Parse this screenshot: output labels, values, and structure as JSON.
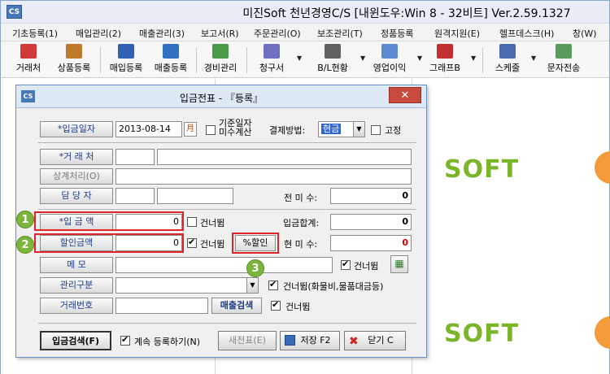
{
  "app": {
    "title": "미진Soft 천년경영C/S [내윈도우:Win 8 - 32비트] Ver.2.59.1327",
    "icon_label": "CS"
  },
  "menu": [
    "기초등록(1)",
    "매입관리(2)",
    "매출관리(3)",
    "보고서(R)",
    "주문관리(O)",
    "보조관리(T)",
    "정품등록",
    "원격지원(E)",
    "헬프데스크(H)",
    "창(W)"
  ],
  "toolbar": [
    {
      "label": "거래처",
      "icon": "customer-icon",
      "color": "#d23a3a"
    },
    {
      "label": "상품등록",
      "icon": "product-box-icon",
      "color": "#c07a2a"
    },
    {
      "label": "매입등록",
      "icon": "purchase-icon",
      "color": "#3060b0"
    },
    {
      "label": "매출등록",
      "icon": "sales-icon",
      "color": "#3070c0"
    },
    {
      "label": "경비관리",
      "icon": "expense-icon",
      "color": "#4a9a4a"
    },
    {
      "label": "청구서",
      "icon": "invoice-icon",
      "color": "#7070c0"
    },
    {
      "label": "B/L현황",
      "icon": "calendar-icon",
      "color": "#606060"
    },
    {
      "label": "영업이익",
      "icon": "profit-icon",
      "color": "#5a8ad0"
    },
    {
      "label": "그래프B",
      "icon": "bar-chart-icon",
      "color": "#c03030"
    },
    {
      "label": "스케줄",
      "icon": "schedule-icon",
      "color": "#4a6ab0"
    },
    {
      "label": "문자전송",
      "icon": "sms-icon",
      "color": "#5a9a5a"
    }
  ],
  "background": {
    "logo_text": "SOFT"
  },
  "dialog": {
    "title": "입금전표 - 『등록』",
    "close_label": "✕",
    "fields": {
      "deposit_date_label": "*입금일자",
      "deposit_date_value": "2013-08-14",
      "calendar_label": "月",
      "base_date_label_1": "기준일자",
      "base_date_label_2": "미수계산",
      "payment_method_label": "결제방법:",
      "payment_method_value": "현금",
      "fixed_label": "고정",
      "customer_label": "*거 래 처",
      "offset_label": "상계처리(O)",
      "manager_label": "담 당 자",
      "prev_balance_label": "전 미 수:",
      "prev_balance_value": "0",
      "amount_label": "*입 금 액",
      "amount_value": "0",
      "skip_label": "건너뜀",
      "total_label": "입금합계:",
      "total_value": "0",
      "discount_label": "할인금액",
      "discount_value": "0",
      "discount_skip_label": "건너뜀",
      "pct_discount_button": "%할인",
      "current_balance_label": "현 미 수:",
      "current_balance_value": "0",
      "memo_label": "메 모",
      "memo_skip_label": "건너뜀",
      "category_label": "관리구분",
      "category_skip_label": "건너뜀(화물비,물품대금등)",
      "trade_no_label": "거래번호",
      "sales_search_button": "매출검색",
      "trade_skip_label": "건너뜀"
    },
    "footer": {
      "deposit_search": "입금검색(F)",
      "continue_label": "계속 등록하기(N)",
      "new_slip": "새전표(E)",
      "save": "저장 F2",
      "close": "닫기 C"
    }
  },
  "annotations": [
    "1",
    "2",
    "3"
  ],
  "colors": {
    "highlight": "#e0242e",
    "badge": "#7cb53b",
    "logo": "#7bb52a"
  }
}
